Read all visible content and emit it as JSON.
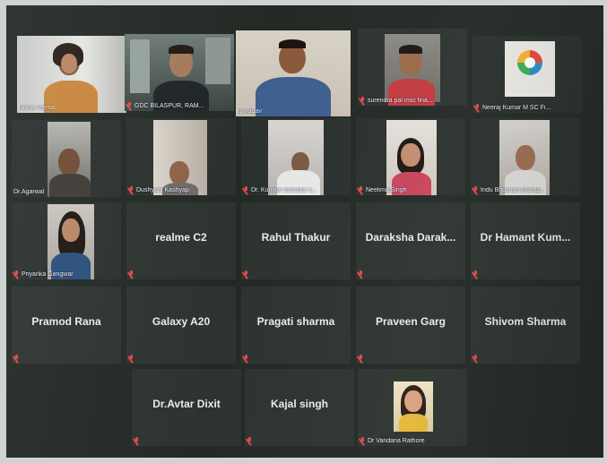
{
  "participants": [
    {
      "name": "Nisha Verma",
      "video": true,
      "speaking": false
    },
    {
      "name": "GDC BILASPUR, RAM...",
      "video": true,
      "speaking": false
    },
    {
      "name": "rp yadav",
      "video": true,
      "speaking": true
    },
    {
      "name": "surendra pal msc fina...",
      "video": true,
      "speaking": false
    },
    {
      "name": "Neeraj Kumar M SC Fi...",
      "video": true,
      "speaking": false
    },
    {
      "name": "Dr.Agarwal",
      "video": true,
      "speaking": false
    },
    {
      "name": "Dushyant Kashyap",
      "video": true,
      "speaking": false
    },
    {
      "name": "Dr. Kunwar bahadur s...",
      "video": true,
      "speaking": false
    },
    {
      "name": "Neelima Singh",
      "video": true,
      "speaking": false
    },
    {
      "name": "Indu Bhushan Mohap...",
      "video": true,
      "speaking": false
    },
    {
      "name": "Priyanka Gangwar",
      "video": true,
      "speaking": false
    },
    {
      "name": "realme C2",
      "video": false,
      "speaking": false
    },
    {
      "name": "Rahul Thakur",
      "video": false,
      "speaking": false
    },
    {
      "name": "Daraksha Darak...",
      "video": false,
      "speaking": false
    },
    {
      "name": "Dr Hamant Kum...",
      "video": false,
      "speaking": false
    },
    {
      "name": "Pramod Rana",
      "video": false,
      "speaking": false
    },
    {
      "name": "Galaxy A20",
      "video": false,
      "speaking": false
    },
    {
      "name": "Pragati sharma",
      "video": false,
      "speaking": false
    },
    {
      "name": "Praveen Garg",
      "video": false,
      "speaking": false
    },
    {
      "name": "Shivom Sharma",
      "video": false,
      "speaking": false
    },
    {
      "name": "Dr.Avtar Dixit",
      "video": false,
      "speaking": false
    },
    {
      "name": "Kajal singh",
      "video": false,
      "speaking": false
    },
    {
      "name": "Dr Vandana Rathore",
      "video": true,
      "speaking": false
    }
  ],
  "colors": {
    "tile_bg": "#2d3430",
    "active_border": "#d9d24a",
    "muted_mic": "#e4484a"
  }
}
